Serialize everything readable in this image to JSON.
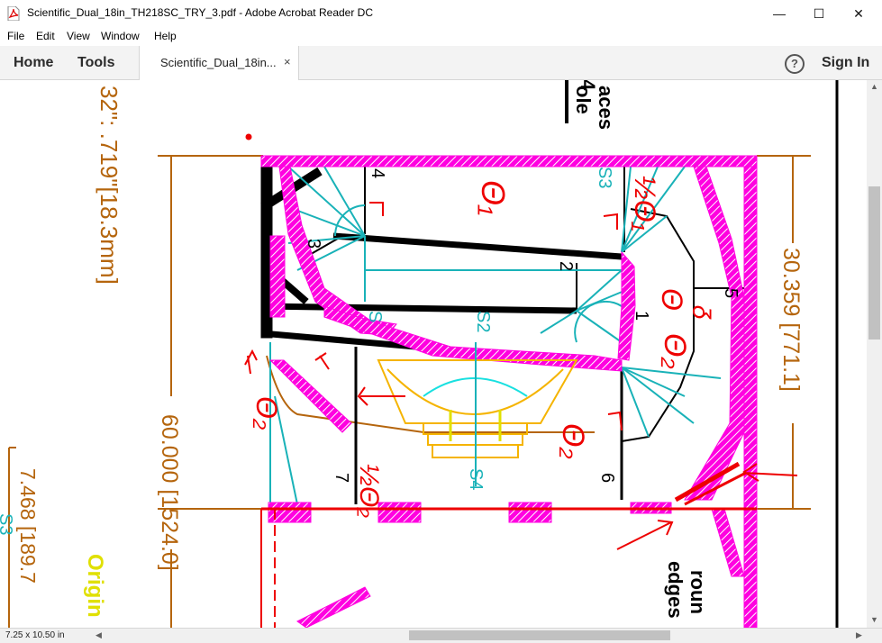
{
  "window": {
    "title": "Scientific_Dual_18in_TH218SC_TRY_3.pdf - Adobe Acrobat Reader DC",
    "minimize": "—",
    "maximize": "☐",
    "close": "✕"
  },
  "menu": [
    "File",
    "Edit",
    "View",
    "Window",
    "Help"
  ],
  "toolbar": {
    "home": "Home",
    "tools": "Tools",
    "tab_label": "Scientific_Dual_18in...",
    "tab_close": "×",
    "help": "?",
    "sign_in": "Sign In"
  },
  "drawing": {
    "dim_top_left": "32\":  .719\"[18.3mm]",
    "dim_height": "60.000  [1524.0]",
    "dim_right": "30.359  [771.1]",
    "dim_bottom_left": "7.468  [189.7",
    "label_s3_bottom": "S3",
    "label_origin": "Origin",
    "label_top_note_1": "ole",
    "label_top_note_2": "aces",
    "label_top_note_3": "4",
    "label_round_1": "roun",
    "label_round_2": "edges",
    "s3_label": "S3",
    "s2_label": "S2",
    "s4_label": "S4",
    "s1_label": "S",
    "n1": "1",
    "n2": "2",
    "n3": "3",
    "n4": "4",
    "n5": "5",
    "n6": "6",
    "n7": "7",
    "hw_theta1": "Θ₁",
    "hw_half_theta1": "½Θ₁",
    "hw_theta_top": "Θ",
    "hw_theta2_right": "Θ₂",
    "hw_theta2_low": "Θ₂",
    "hw_half_theta2": "½Θ₂",
    "hw_theta_left": "Θ₂",
    "hw_marker_5": "ᵹ"
  },
  "colors": {
    "brown": "#b5650d",
    "magenta": "#ff00e0",
    "red": "#ee0000",
    "teal": "#19b2b8",
    "orange": "#f5b400",
    "yellow": "#e0e000",
    "black": "#000000"
  },
  "status": {
    "page_size": "7.25 x 10.50 in"
  }
}
